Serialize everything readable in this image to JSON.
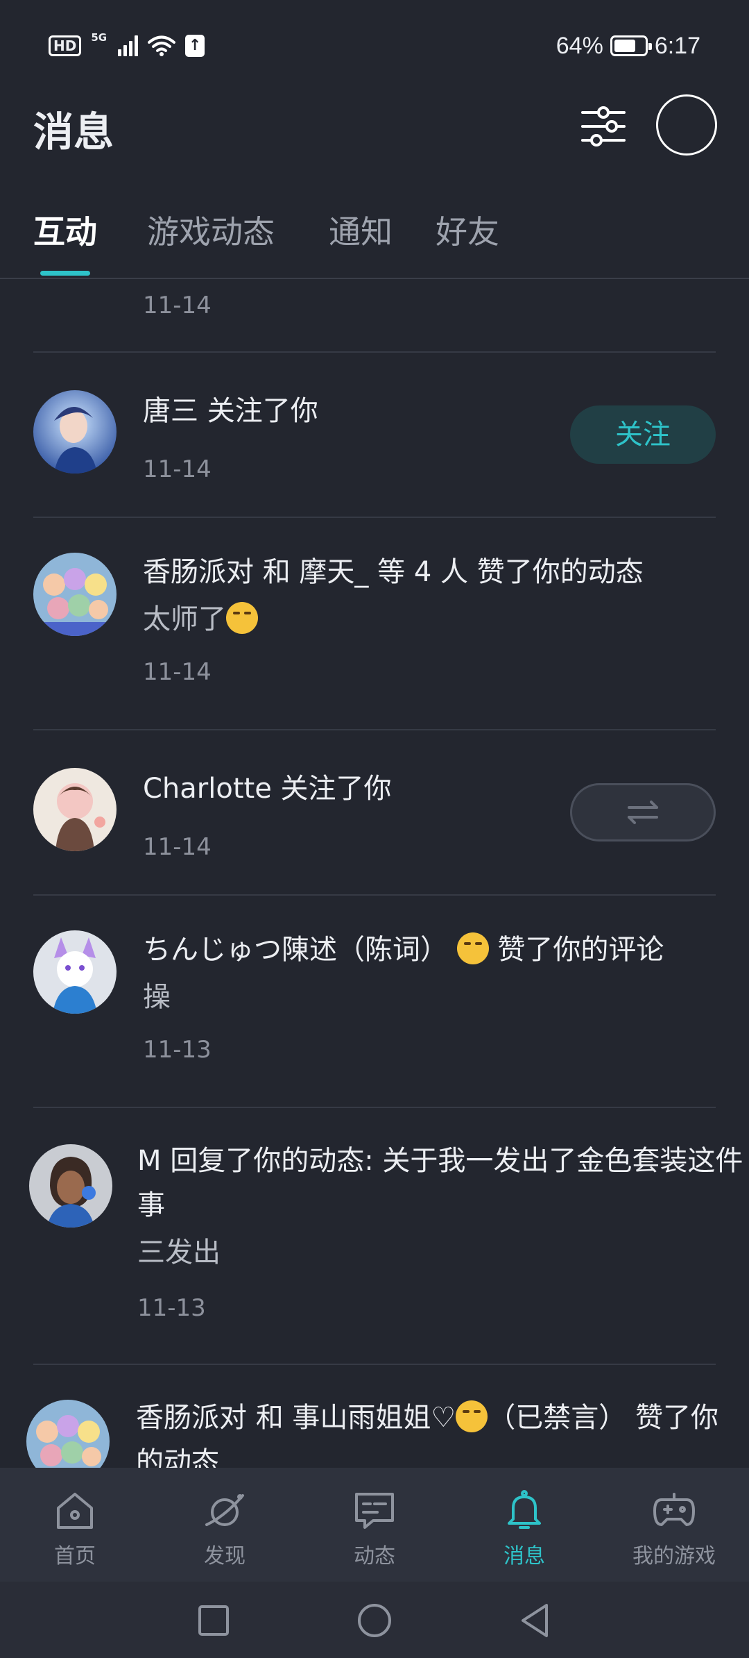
{
  "status_bar": {
    "hd_label": "HD",
    "network_label": "5G",
    "battery_percent": "64%",
    "battery_level": 0.64,
    "time": "6:17"
  },
  "header": {
    "title": "消息",
    "filter_icon": "sliders-icon",
    "avatar_icon": "profile-avatar-placeholder"
  },
  "tabs": [
    {
      "label": "互动",
      "active": true
    },
    {
      "label": "游戏动态",
      "active": false
    },
    {
      "label": "通知",
      "active": false
    },
    {
      "label": "好友",
      "active": false
    }
  ],
  "messages": [
    {
      "title": "",
      "content": "",
      "date": "11-14"
    },
    {
      "title": "唐三 关注了你",
      "content": "",
      "date": "11-14",
      "action": "关注"
    },
    {
      "title": "香肠派对 和 摩天_ 等 4 人 赞了你的动态",
      "content": "太师了",
      "date": "11-14"
    },
    {
      "title": "Charlotte 关注了你",
      "content": "",
      "date": "11-14",
      "action_icon": "mutual-arrows-icon"
    },
    {
      "title_a": "ちんじゅつ陳述（陈词）",
      "title_b": " 赞了你的评论",
      "content": "操",
      "date": "11-13"
    },
    {
      "title": "M 回复了你的动态: 关于我一发出了金色套装这件事",
      "content": "三发出",
      "date": "11-13"
    },
    {
      "title_a": "香肠派对 和 事山雨姐姐♡",
      "title_b": "（已禁言） 赞了你的动态",
      "content": "",
      "date": ""
    }
  ],
  "bottom_nav": [
    {
      "label": "首页",
      "icon": "home-icon",
      "active": false
    },
    {
      "label": "发现",
      "icon": "discover-planet-icon",
      "active": false
    },
    {
      "label": "动态",
      "icon": "feed-message-icon",
      "active": false
    },
    {
      "label": "消息",
      "icon": "bell-icon",
      "active": true
    },
    {
      "label": "我的游戏",
      "icon": "gamepad-icon",
      "active": false
    }
  ],
  "colors": {
    "background": "#23262f",
    "accent": "#2ec3c9",
    "nav_bar": "#2e323d"
  }
}
